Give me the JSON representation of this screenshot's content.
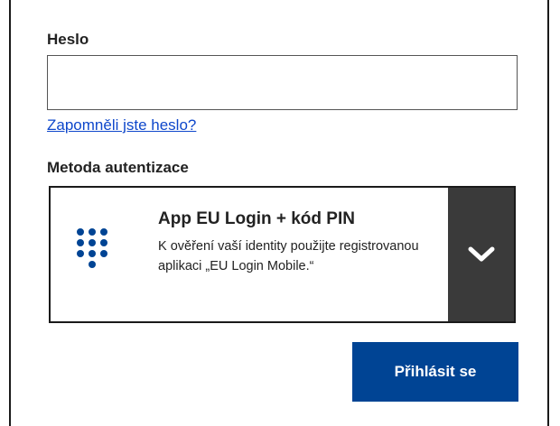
{
  "password": {
    "label": "Heslo",
    "value": "",
    "forgot_link": "Zapomněli jste heslo?"
  },
  "auth_method": {
    "label": "Metoda autentizace",
    "selected": {
      "title": "App EU Login + kód PIN",
      "description": "K ověření vaší identity použijte registrovanou aplikaci „EU Login Mobile.“",
      "icon": "keypad-icon"
    },
    "toggle_icon": "chevron-down-icon"
  },
  "submit": {
    "label": "Přihlásit se"
  },
  "colors": {
    "link": "#0e47cb",
    "primary_button": "#004494",
    "keypad_icon": "#004494",
    "toggle_bg": "#3a3a3a"
  }
}
